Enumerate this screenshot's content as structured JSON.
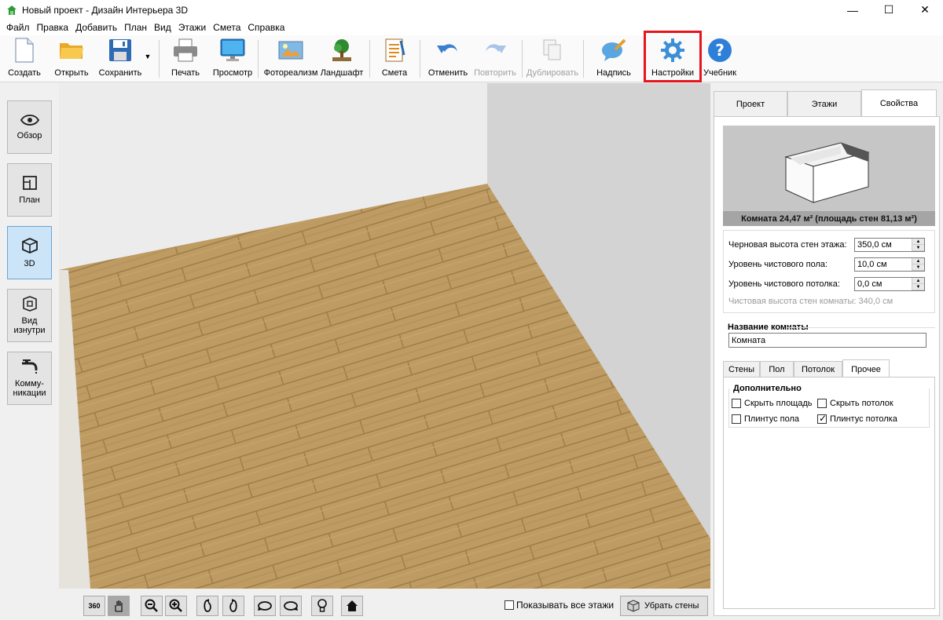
{
  "window": {
    "title": "Новый проект - Дизайн Интерьера 3D",
    "minimize": "—",
    "maximize": "☐",
    "close": "✕"
  },
  "menu": [
    "Файл",
    "Правка",
    "Добавить",
    "План",
    "Вид",
    "Этажи",
    "Смета",
    "Справка"
  ],
  "toolbar": {
    "create": "Создать",
    "open": "Открыть",
    "save": "Сохранить",
    "print": "Печать",
    "preview": "Просмотр",
    "photorealism": "Фотореализм",
    "landscape": "Ландшафт",
    "estimate": "Смета",
    "undo": "Отменить",
    "redo": "Повторить",
    "duplicate": "Дублировать",
    "caption": "Надпись",
    "settings": "Настройки",
    "tutorial": "Учебник",
    "save_dropdown": "▼"
  },
  "left_nav": {
    "overview": "Обзор",
    "plan": "План",
    "3d": "3D",
    "inside_view": "Вид изнутри",
    "utilities": "Комму-никации"
  },
  "bottom": {
    "show_all_floors": "Показывать все этажи",
    "remove_walls": "Убрать стены",
    "btn_360": "360"
  },
  "right": {
    "tabs": [
      "Проект",
      "Этажи",
      "Свойства"
    ],
    "room_caption": "Комната 24,47 м²  (площадь стен 81,13 м²)",
    "params": {
      "rough_height_label": "Черновая высота стен этажа:",
      "rough_height_value": "350,0 см",
      "floor_level_label": "Уровень чистового пола:",
      "floor_level_value": "10,0 см",
      "ceiling_level_label": "Уровень чистового потолка:",
      "ceiling_level_value": "0,0 см",
      "clean_height_note": "Чистовая высота стен комнаты: 340,0 см"
    },
    "room_name_label": "Название комнаты",
    "room_name_value": "Комната",
    "subtabs": [
      "Стены",
      "Пол",
      "Потолок",
      "Прочее"
    ],
    "extra_title": "Дополнительно",
    "checkboxes": {
      "hide_area": "Скрыть площадь",
      "hide_ceiling": "Скрыть потолок",
      "floor_plinth": "Плинтус пола",
      "ceiling_plinth": "Плинтус потолка"
    }
  },
  "colors": {
    "highlight": "#e8141d",
    "active_nav": "#cce4f7",
    "floor_wood": "#b9975e"
  }
}
